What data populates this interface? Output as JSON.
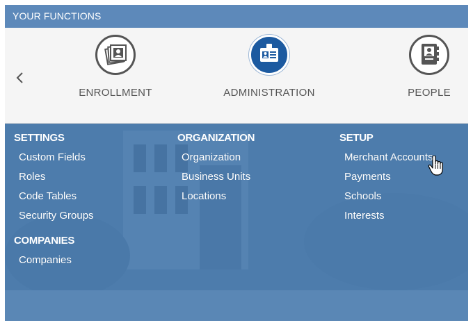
{
  "header": {
    "title": "YOUR FUNCTIONS"
  },
  "carousel": {
    "prev_icon": "chevron-left-icon",
    "functions": [
      {
        "label": "ENROLLMENT",
        "icon": "photo-id-stack-icon",
        "active": false
      },
      {
        "label": "ADMINISTRATION",
        "icon": "id-badge-icon",
        "active": true
      },
      {
        "label": "PEOPLE",
        "icon": "address-book-icon",
        "active": false
      }
    ]
  },
  "menu": {
    "settings": {
      "heading": "SETTINGS",
      "items": [
        "Custom Fields",
        "Roles",
        "Code Tables",
        "Security Groups"
      ]
    },
    "companies": {
      "heading": "COMPANIES",
      "items": [
        "Companies"
      ]
    },
    "organization": {
      "heading": "ORGANIZATION",
      "items": [
        "Organization",
        "Business Units",
        "Locations"
      ]
    },
    "setup": {
      "heading": "SETUP",
      "items": [
        "Merchant Accounts",
        "Payments",
        "Schools",
        "Interests"
      ]
    }
  },
  "colors": {
    "header_bg": "#5d89ba",
    "active_circle": "#1c5aa0",
    "menu_bg": "#4f7eae"
  }
}
